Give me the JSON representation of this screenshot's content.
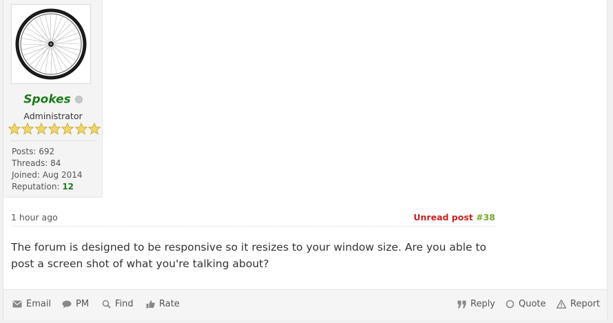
{
  "profile": {
    "username": "Spokes",
    "status": "offline",
    "user_title": "Administrator",
    "stars": 7,
    "stats": {
      "posts_label": "Posts:",
      "posts_value": "692",
      "threads_label": "Threads:",
      "threads_value": "84",
      "joined_label": "Joined:",
      "joined_value": "Aug 2014",
      "reputation_label": "Reputation:",
      "reputation_value": "12"
    }
  },
  "post": {
    "time": "1 hour ago",
    "unread_label": "Unread post",
    "number": "#38",
    "body": "The forum is designed to be responsive so it resizes to your window size. Are you able to post a screen shot of what you're talking about?"
  },
  "footer": {
    "email_label": "Email",
    "pm_label": "PM",
    "find_label": "Find",
    "rate_label": "Rate",
    "reply_label": "Reply",
    "quote_label": "Quote",
    "report_label": "Report"
  },
  "colors": {
    "username": "#1d7a1d",
    "unread": "#cc1f1f",
    "post_number": "#79a82a",
    "reputation": "#1d7a1d",
    "footer_bg": "#f5f5f5"
  }
}
